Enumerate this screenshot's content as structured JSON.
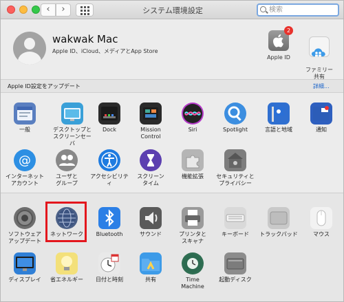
{
  "window": {
    "title": "システム環境設定",
    "search_placeholder": "検索"
  },
  "account": {
    "name": "wakwak Mac",
    "subtitle": "Apple ID、iCloud、メディアとApp Store"
  },
  "top_icons": [
    {
      "label": "Apple ID",
      "badge": "2"
    },
    {
      "label": "ファミリー\n共有"
    }
  ],
  "banner": {
    "text": "Apple ID設定をアップデート",
    "link": "詳細..."
  },
  "row1": [
    {
      "label": "一般",
      "icon": "general-icon",
      "color": "#5a7fc0"
    },
    {
      "label": "デスクトップと\nスクリーンセーバ",
      "icon": "desktop-icon",
      "color": "#3aa0d8"
    },
    {
      "label": "Dock",
      "icon": "dock-icon",
      "color": "#2b2b2b"
    },
    {
      "label": "Mission\nControl",
      "icon": "mission-control-icon",
      "color": "#2a2a2a"
    },
    {
      "label": "Siri",
      "icon": "siri-icon",
      "color": "#b43ac8"
    },
    {
      "label": "Spotlight",
      "icon": "spotlight-icon",
      "color": "#3c8ee0"
    },
    {
      "label": "言語と地域",
      "icon": "language-icon",
      "color": "#2f6fd0"
    },
    {
      "label": "通知",
      "icon": "notifications-icon",
      "color": "#2e5fbf"
    }
  ],
  "row2": [
    {
      "label": "インターネット\nアカウント",
      "icon": "internet-accounts-icon",
      "color": "#2d8fe3"
    },
    {
      "label": "ユーザと\nグループ",
      "icon": "users-groups-icon",
      "color": "#888888"
    },
    {
      "label": "アクセシビリティ",
      "icon": "accessibility-icon",
      "color": "#1e7be0"
    },
    {
      "label": "スクリーン\nタイム",
      "icon": "screen-time-icon",
      "color": "#5c3fb0"
    },
    {
      "label": "機能拡張",
      "icon": "extensions-icon",
      "color": "#b5b5b5"
    },
    {
      "label": "セキュリティと\nプライバシー",
      "icon": "security-privacy-icon",
      "color": "#7d7d7d"
    }
  ],
  "row3": [
    {
      "label": "ソフトウェア\nアップデート",
      "icon": "software-update-icon",
      "color": "#6e6e6e"
    },
    {
      "label": "ネットワーク",
      "icon": "network-icon",
      "color": "#4a5f86"
    },
    {
      "label": "Bluetooth",
      "icon": "bluetooth-icon",
      "color": "#2b7fe6"
    },
    {
      "label": "サウンド",
      "icon": "sound-icon",
      "color": "#5a5a5a"
    },
    {
      "label": "プリンタと\nスキャナ",
      "icon": "printers-icon",
      "color": "#9a9a9a"
    },
    {
      "label": "キーボード",
      "icon": "keyboard-icon",
      "color": "#d9d9d9"
    },
    {
      "label": "トラックパッド",
      "icon": "trackpad-icon",
      "color": "#c9c9c9"
    },
    {
      "label": "マウス",
      "icon": "mouse-icon",
      "color": "#f2f2f2"
    }
  ],
  "row4": [
    {
      "label": "ディスプレイ",
      "icon": "displays-icon",
      "color": "#2f7fd6"
    },
    {
      "label": "省エネルギー",
      "icon": "energy-saver-icon",
      "color": "#f3e07a"
    },
    {
      "label": "日付と時刻",
      "icon": "date-time-icon",
      "color": "#e9e9e9"
    },
    {
      "label": "共有",
      "icon": "sharing-icon",
      "color": "#3d9be8"
    },
    {
      "label": "Time\nMachine",
      "icon": "time-machine-icon",
      "color": "#2f6e52"
    },
    {
      "label": "起動ディスク",
      "icon": "startup-disk-icon",
      "color": "#8c8c8c"
    }
  ]
}
